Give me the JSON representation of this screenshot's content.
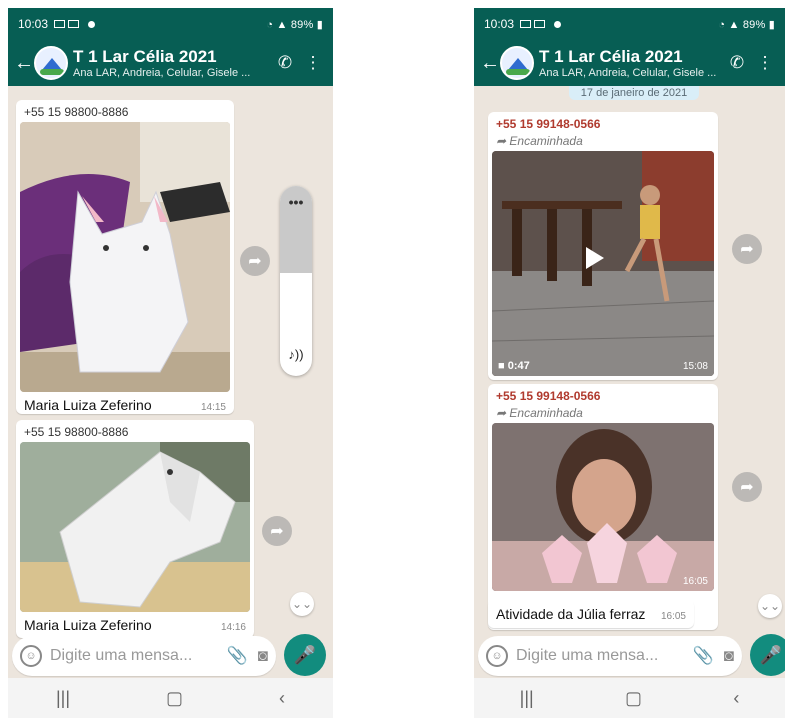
{
  "status": {
    "time": "10:03",
    "right_indicators": "89%"
  },
  "header": {
    "title": "T 1 Lar Célia 2021",
    "subtitle": "Ana LAR, Andreia, Celular, Gisele ..."
  },
  "left": {
    "messages": [
      {
        "sender": "+55 15 98800-8886",
        "caption": "Maria Luiza Zeferino",
        "time": "14:15"
      },
      {
        "sender": "+55 15 98800-8886",
        "caption": "Maria Luiza Zeferino",
        "time": "14:16"
      }
    ],
    "volume_level": 0.54
  },
  "right": {
    "date_chip": "17 de janeiro de 2021",
    "messages": [
      {
        "sender": "+55 15 99148-0566",
        "forwarded": "Encaminhada",
        "duration": "0:47",
        "time": "15:08"
      },
      {
        "sender": "+55 15 99148-0566",
        "forwarded": "Encaminhada",
        "media_time": "16:05",
        "caption": "Atividade da Júlia ferraz",
        "time": "16:05"
      }
    ]
  },
  "input": {
    "placeholder": "Digite uma mensa..."
  },
  "icons": {
    "back": "arrow-left-icon",
    "call": "add-call-icon",
    "menu": "more-vert-icon",
    "emoji": "emoji-icon",
    "attach": "paperclip-icon",
    "camera": "camera-icon",
    "mic": "mic-icon",
    "share": "forward-icon"
  },
  "colors": {
    "header": "#075e54",
    "chat_bg": "#ece5dd",
    "mic": "#128c7e"
  }
}
